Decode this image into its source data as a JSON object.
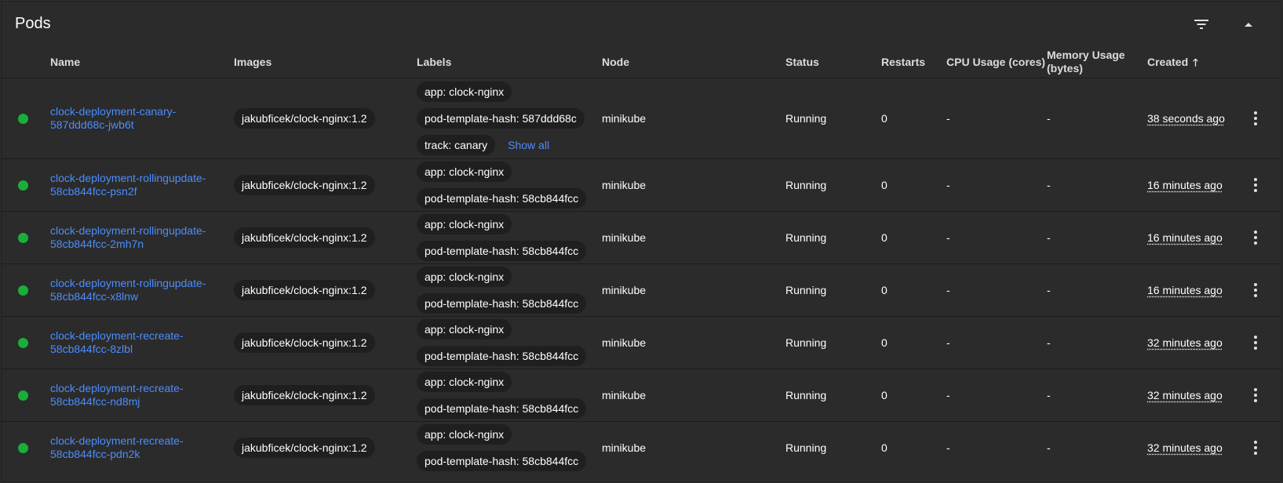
{
  "header": {
    "title": "Pods"
  },
  "columns": {
    "name": "Name",
    "images": "Images",
    "labels": "Labels",
    "node": "Node",
    "status": "Status",
    "restarts": "Restarts",
    "cpu": "CPU Usage (cores)",
    "memory_line1": "Memory Usage",
    "memory_line2": "(bytes)",
    "created": "Created"
  },
  "colors": {
    "link": "#4c8dff",
    "status_running": "#1aae3a"
  },
  "pods": [
    {
      "name_line1": "clock-deployment-canary-",
      "name_line2": "587ddd68c-jwb6t",
      "image": "jakubficek/clock-nginx:1.2",
      "label1": "app: clock-nginx",
      "label2": "pod-template-hash: 587ddd68c",
      "label3": "track: canary",
      "show_all": "Show all",
      "node": "minikube",
      "status": "Running",
      "restarts": "0",
      "cpu": "-",
      "memory": "-",
      "created": "38 seconds ago"
    },
    {
      "name_line1": "clock-deployment-rollingupdate-",
      "name_line2": "58cb844fcc-psn2f",
      "image": "jakubficek/clock-nginx:1.2",
      "label1": "app: clock-nginx",
      "label2": "pod-template-hash: 58cb844fcc",
      "node": "minikube",
      "status": "Running",
      "restarts": "0",
      "cpu": "-",
      "memory": "-",
      "created": "16 minutes ago"
    },
    {
      "name_line1": "clock-deployment-rollingupdate-",
      "name_line2": "58cb844fcc-2mh7n",
      "image": "jakubficek/clock-nginx:1.2",
      "label1": "app: clock-nginx",
      "label2": "pod-template-hash: 58cb844fcc",
      "node": "minikube",
      "status": "Running",
      "restarts": "0",
      "cpu": "-",
      "memory": "-",
      "created": "16 minutes ago"
    },
    {
      "name_line1": "clock-deployment-rollingupdate-",
      "name_line2": "58cb844fcc-x8lnw",
      "image": "jakubficek/clock-nginx:1.2",
      "label1": "app: clock-nginx",
      "label2": "pod-template-hash: 58cb844fcc",
      "node": "minikube",
      "status": "Running",
      "restarts": "0",
      "cpu": "-",
      "memory": "-",
      "created": "16 minutes ago"
    },
    {
      "name_line1": "clock-deployment-recreate-",
      "name_line2": "58cb844fcc-8zlbl",
      "image": "jakubficek/clock-nginx:1.2",
      "label1": "app: clock-nginx",
      "label2": "pod-template-hash: 58cb844fcc",
      "node": "minikube",
      "status": "Running",
      "restarts": "0",
      "cpu": "-",
      "memory": "-",
      "created": "32 minutes ago"
    },
    {
      "name_line1": "clock-deployment-recreate-",
      "name_line2": "58cb844fcc-nd8mj",
      "image": "jakubficek/clock-nginx:1.2",
      "label1": "app: clock-nginx",
      "label2": "pod-template-hash: 58cb844fcc",
      "node": "minikube",
      "status": "Running",
      "restarts": "0",
      "cpu": "-",
      "memory": "-",
      "created": "32 minutes ago"
    },
    {
      "name_line1": "clock-deployment-recreate-",
      "name_line2": "58cb844fcc-pdn2k",
      "image": "jakubficek/clock-nginx:1.2",
      "label1": "app: clock-nginx",
      "label2": "pod-template-hash: 58cb844fcc",
      "node": "minikube",
      "status": "Running",
      "restarts": "0",
      "cpu": "-",
      "memory": "-",
      "created": "32 minutes ago"
    }
  ]
}
